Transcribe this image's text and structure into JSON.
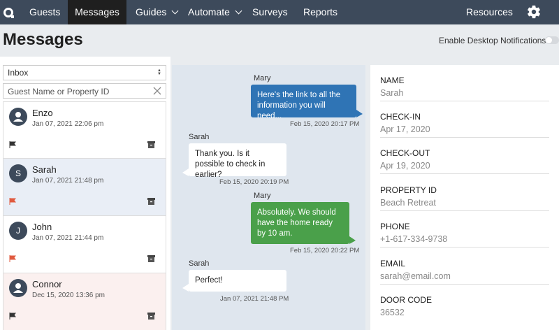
{
  "nav": {
    "items": [
      {
        "label": "Guests"
      },
      {
        "label": "Messages"
      },
      {
        "label": "Guides"
      },
      {
        "label": "Automate"
      },
      {
        "label": "Surveys"
      },
      {
        "label": "Reports"
      }
    ],
    "resources_label": "Resources",
    "icons": {
      "logo": "logo-icon",
      "settings": "gear-icon",
      "dropdown": "chevron-down-icon"
    }
  },
  "header": {
    "title": "Messages",
    "notifications_label": "Enable Desktop Notifications:",
    "notifications_enabled": false
  },
  "filter": {
    "inbox_value": "Inbox",
    "search_placeholder": "Guest Name or Property ID"
  },
  "guests": [
    {
      "initial": "",
      "name": "Enzo",
      "date": "Jan 07, 2021 22:06 pm",
      "flag_color": "#333333",
      "bg": "#ffffff"
    },
    {
      "initial": "S",
      "name": "Sarah",
      "date": "Jan 07, 2021 21:48 pm",
      "flag_color": "#e05a3f",
      "bg": "#e9eef6"
    },
    {
      "initial": "J",
      "name": "John",
      "date": "Jan 07, 2021 21:44 pm",
      "flag_color": "#e05a3f",
      "bg": "#ffffff"
    },
    {
      "initial": "",
      "name": "Connor",
      "date": "Dec 15, 2020 13:36 pm",
      "flag_color": "#333333",
      "bg": "#fbf0ef"
    }
  ],
  "messages": [
    {
      "sender": "Mary",
      "text": "Here's the link to all the information you will need...",
      "time": "Feb 15, 2020 20:17 PM",
      "style": "blue"
    },
    {
      "sender": "Sarah",
      "text": "Thank you. Is it possible to check in earlier?",
      "time": "Feb 15, 2020 20:19 PM",
      "style": "white"
    },
    {
      "sender": "Mary",
      "text": "Absolutely. We should have the home ready by 10 am.",
      "time": "Feb 15, 2020 20:22 PM",
      "style": "green"
    },
    {
      "sender": "Sarah",
      "text": "Perfect!",
      "time": "Jan 07, 2021 21:48 PM",
      "style": "white"
    }
  ],
  "details": [
    {
      "label": "NAME",
      "value": "Sarah"
    },
    {
      "label": "CHECK-IN",
      "value": "Apr 17, 2020"
    },
    {
      "label": "CHECK-OUT",
      "value": "Apr 19, 2020"
    },
    {
      "label": "PROPERTY ID",
      "value": "Beach Retreat"
    },
    {
      "label": "PHONE",
      "value": "+1-617-334-9738"
    },
    {
      "label": "EMAIL",
      "value": "sarah@email.com"
    },
    {
      "label": "DOOR CODE",
      "value": "36532"
    }
  ],
  "colors": {
    "nav_bg": "#3d4a5b",
    "nav_active": "#1f1f1f",
    "bubble_blue": "#2f74b5",
    "bubble_green": "#4aa04a",
    "flag_red": "#e05a3f"
  }
}
